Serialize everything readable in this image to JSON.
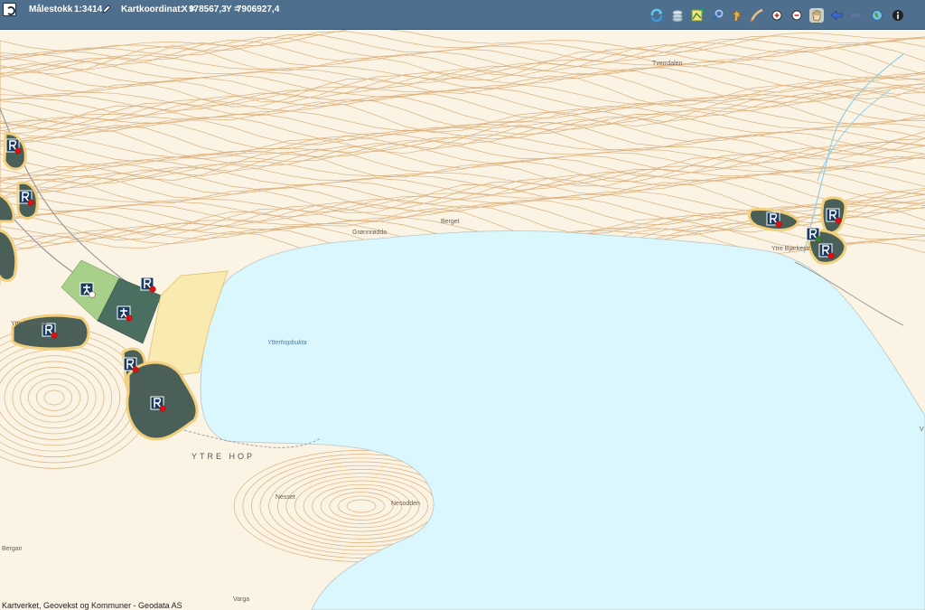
{
  "toolbar": {
    "scale_label": "Målestokk",
    "scale_value": "1:3414",
    "coord_label": "Kartkoordinat:",
    "x_label": "X =",
    "x_value": "978567,3",
    "y_label": "Y =",
    "y_value": "7906927,4",
    "tools": [
      "refresh-icon",
      "layers-icon",
      "map-export-icon",
      "search-icon",
      "identify-icon",
      "measure-icon",
      "zoom-in-icon",
      "zoom-out-icon",
      "pan-icon",
      "back-icon",
      "forward-icon",
      "globe-icon",
      "info-icon"
    ]
  },
  "map": {
    "place_names": {
      "tverrdalen": "Tverrdalen",
      "bergat": "Berget",
      "grenneradda": "Grønnrødda",
      "ytre_bjerkestr": "Ytre Bjørkestr.",
      "ytterhopbukta": "Ytterhopbukta",
      "ytterhopheva": "Ytterhopheia",
      "ytre_hop": "YTRE HOP",
      "nesset": "Nesset",
      "nesodden": "Nesodden",
      "bergan": "Bergan",
      "varga": "Varga",
      "v_edge": "V"
    },
    "colors": {
      "sea": "#d9f7fd",
      "land": "#fbf3e4",
      "contour": "#d8a56a",
      "dark_area": "#4a5f58",
      "light_green": "#a8d08a",
      "yellow_area": "#f8eab0",
      "marker_bg": "#1a3a5f",
      "dot": "#e01010"
    }
  },
  "attribution": "Kartverket, Geovekst og Kommuner - Geodata AS"
}
